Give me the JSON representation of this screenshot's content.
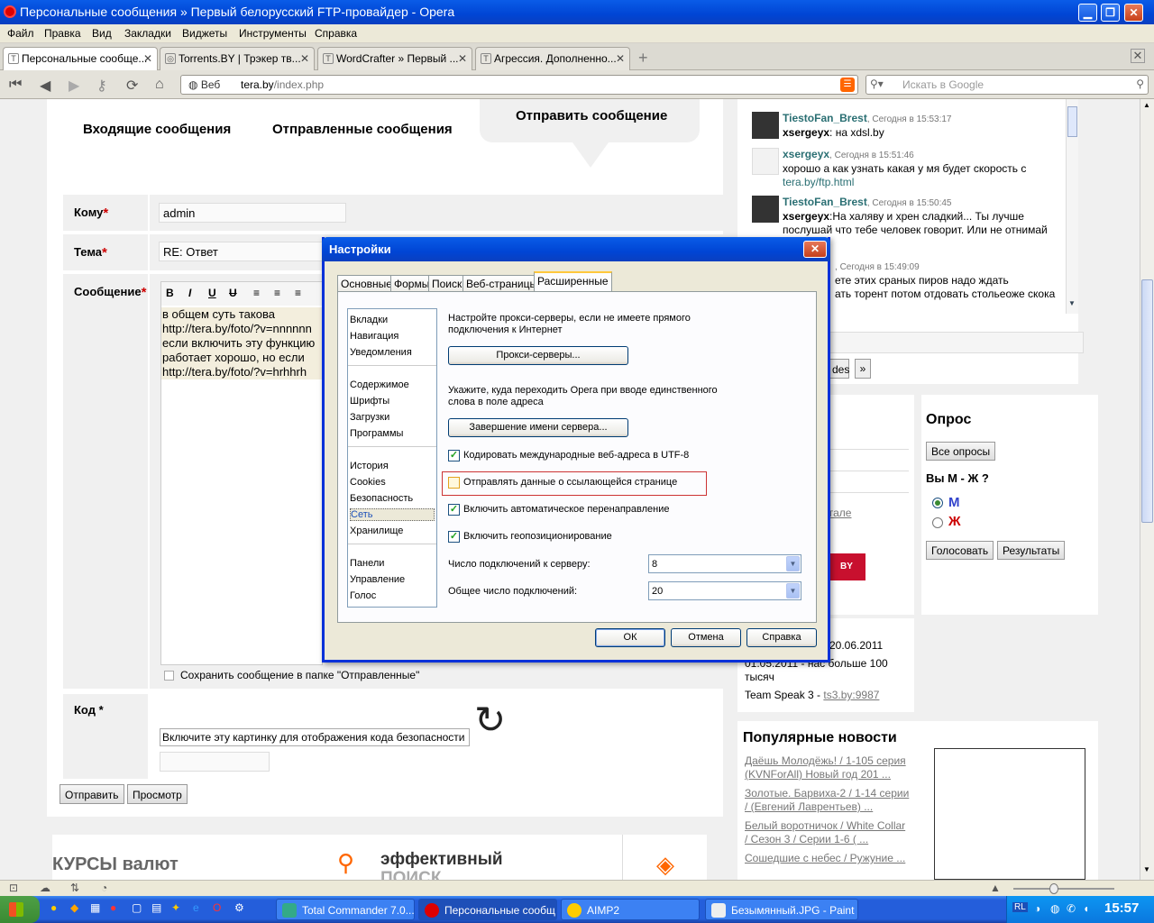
{
  "window": {
    "title": "Персональные сообщения » Первый белорусский FTP-провайдер - Opera",
    "min": "▁",
    "max": "❐",
    "close": "✕"
  },
  "menu": [
    "Файл",
    "Правка",
    "Вид",
    "Закладки",
    "Виджеты",
    "Инструменты",
    "Справка"
  ],
  "tabs": [
    "Персональные сообще...",
    "Torrents.BY | Трэкер тв...",
    "WordCrafter » Первый ...",
    "Агрессия. Дополненно..."
  ],
  "address": {
    "scheme_label": "Веб",
    "url_domain": "tera.by",
    "url_path": "/index.php",
    "search_placeholder": "Искать в Google"
  },
  "pm": {
    "tab_inbox": "Входящие сообщения",
    "tab_sent": "Отправленные сообщения",
    "tab_send": "Отправить сообщение",
    "to_label": "Кому",
    "to_value": "admin",
    "subject_label": "Тема",
    "subject_value": "RE: Ответ",
    "message_label": "Сообщение",
    "message_lines": [
      "в общем суть такова",
      "http://tera.by/foto/?v=nnnnnn",
      "если включить эту функцию",
      "работает хорошо, но если",
      "http://tera.by/foto/?v=hrhhrh"
    ],
    "save_copy_label": "Сохранить сообщение в папке \"Отправленные\"",
    "code_label": "Код",
    "captcha_alt": "Включите эту картинку для отображения кода безопасности",
    "send_button": "Отправить",
    "preview_button": "Просмотр",
    "banner_currency": "КУРСЫ валют",
    "banner_search_1": "эффективный",
    "banner_search_2": "ПОИСК"
  },
  "chat": [
    {
      "name": "TiestoFan_Brest",
      "time": "Сегодня в 15:53:17",
      "who": "xsergeyx",
      "text": ": на xdsl.by"
    },
    {
      "name": "xsergeyx",
      "time": "Сегодня в 15:51:46",
      "text": "хорошо а как узнать какая у мя будет скорость с",
      "link": "tera.by/ftp.html"
    },
    {
      "name": "TiestoFan_Brest",
      "time": "Сегодня в 15:50:45",
      "who": "xsergeyx",
      "text": ":На халяву и хрен сладкий... Ты лучше послушай что тебе человек говорит. Или не отнимай",
      "tail": "а."
    },
    {
      "time": "Сегодня в 15:49:09",
      "text1": "ете этих сраных пиров надо ждать",
      "text2": "ать торент потом отдовать стольеоже скока"
    }
  ],
  "chat_fragment": "des",
  "chat_more": "»",
  "poll": {
    "title": "Опрос",
    "all_button": "Все опросы",
    "question": "Вы М - Ж ?",
    "options": [
      "М",
      "Ж"
    ],
    "vote_button": "Голосовать",
    "results_button": "Результаты"
  },
  "news_links": {
    "partial_link": "гале",
    "date_frag": "20.06.2011",
    "item2": "01.05.2011 - нас больше 100 тысяч",
    "item3_text": "Team Speak 3 - ",
    "item3_link": "ts3.by:9987"
  },
  "popular": {
    "title": "Популярные новости",
    "items": [
      "Даёшь Молодёжь! / 1-105 серия (KVNForAll) Новый год 201 ...",
      "Золотые. Барвиха-2 / 1-14 серии / (Евгений Лаврентьев) ...",
      "Белый воротничок / White Collar / Сезон 3 / Серии 1-6 ( ...",
      "Сошедшие с небес / Ружуние ..."
    ]
  },
  "dialog": {
    "title": "Настройки",
    "tabs": [
      "Основные",
      "Формы",
      "Поиск",
      "Веб-страницы",
      "Расширенные"
    ],
    "categories": [
      "Вкладки",
      "Навигация",
      "Уведомления",
      "Содержимое",
      "Шрифты",
      "Загрузки",
      "Программы",
      "История",
      "Cookies",
      "Безопасность",
      "Сеть",
      "Хранилище",
      "Панели",
      "Управление",
      "Голос"
    ],
    "proxy_text": "Настройте прокси-серверы, если не имеете прямого подключения к Интернет",
    "proxy_button": "Прокси-серверы...",
    "server_text": "Укажите, куда переходить Opera при вводе единственного слова в поле адреса",
    "server_button": "Завершение имени сервера...",
    "cb_utf8": "Кодировать международные веб-адреса в UTF-8",
    "cb_referrer": "Отправлять данные о ссылающейся странице",
    "cb_redirect": "Включить автоматическое перенаправление",
    "cb_geo": "Включить геопозиционирование",
    "conn_server_label": "Число подключений к серверу:",
    "conn_server_value": "8",
    "conn_total_label": "Общее число подключений:",
    "conn_total_value": "20",
    "ok": "ОК",
    "cancel": "Отмена",
    "help": "Справка"
  },
  "taskbar": {
    "tasks": [
      "Total Commander 7.0...",
      "Персональные сообщ...",
      "AIMP2",
      "Безымянный.JPG - Paint"
    ],
    "lang": "RL",
    "clock": "15:57"
  }
}
